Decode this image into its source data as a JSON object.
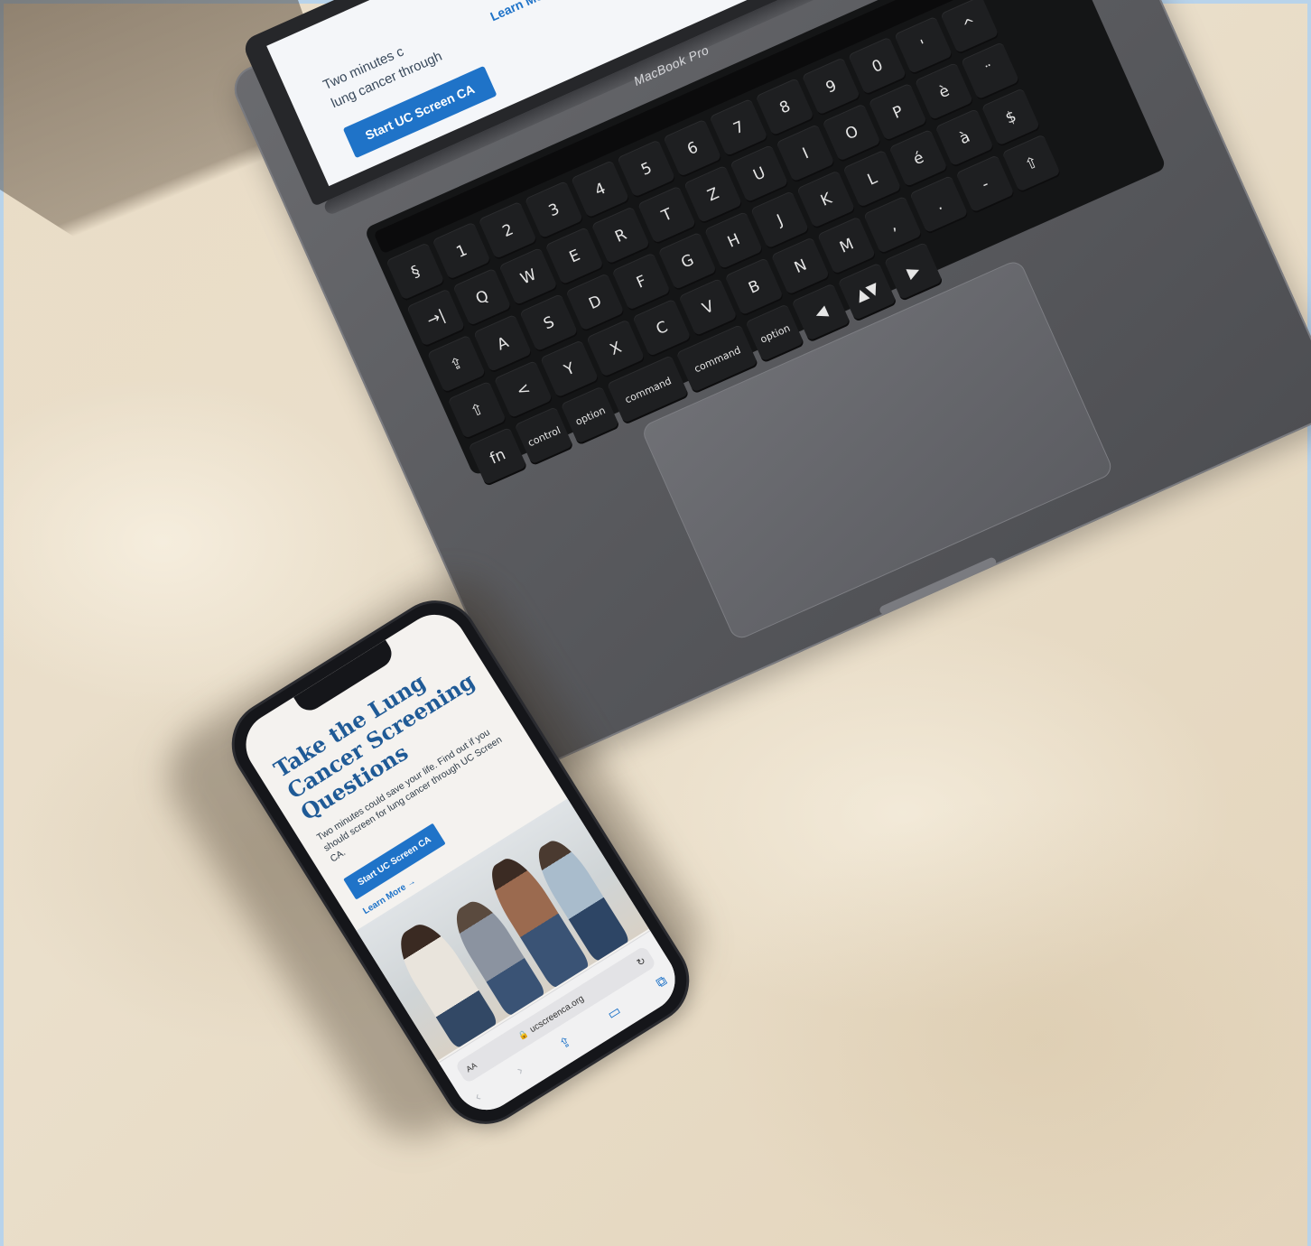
{
  "laptop": {
    "brand": "MacBook Pro",
    "screen": {
      "line1": "Two minutes c",
      "line2": "lung cancer through",
      "cta": "Start UC Screen CA",
      "learn_more": "Learn Mo"
    },
    "keys": {
      "row_num": [
        "§",
        "1",
        "2",
        "3",
        "4",
        "5",
        "6",
        "7",
        "8",
        "9",
        "0",
        "'",
        "^"
      ],
      "row_q": [
        "→|",
        "Q",
        "W",
        "E",
        "R",
        "T",
        "Z",
        "U",
        "I",
        "O",
        "P",
        "è",
        "¨"
      ],
      "row_a": [
        "⇪",
        "A",
        "S",
        "D",
        "F",
        "G",
        "H",
        "J",
        "K",
        "L",
        "é",
        "à",
        "$"
      ],
      "row_y": [
        "⇧",
        "<",
        "Y",
        "X",
        "C",
        "V",
        "B",
        "N",
        "M",
        ",",
        ".",
        "-",
        "⇧"
      ],
      "row_fn": [
        "fn",
        "control",
        "option",
        "command",
        "command",
        "option",
        "◀",
        "▲▼",
        "▶"
      ]
    }
  },
  "phone": {
    "hero_title": "Take the Lung Cancer Screening Questions",
    "hero_body": "Two minutes could save your life. Find out if you should screen for lung cancer through UC Screen CA.",
    "cta": "Start UC Screen CA",
    "learn_more": "Learn More →",
    "browser": {
      "aa": "AA",
      "url": "ucscreenca.org"
    },
    "icons": {
      "back": "back-icon",
      "forward": "forward-icon",
      "share": "share-icon",
      "bookmarks": "bookmarks-icon",
      "tabs": "tabs-icon",
      "reload": "reload-icon",
      "lock": "lock-icon"
    }
  },
  "colors": {
    "accent_blue": "#1f73c8",
    "heading_blue": "#1f5a96",
    "floor": "#eadfcb",
    "laptop": "#5a5b5f"
  }
}
